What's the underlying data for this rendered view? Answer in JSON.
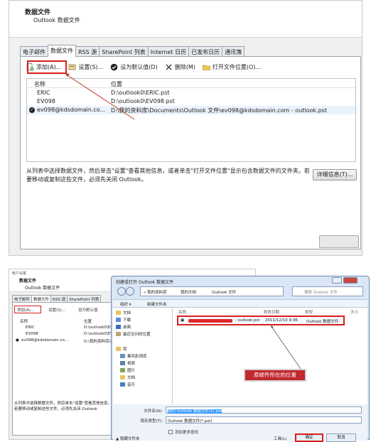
{
  "top": {
    "header_title": "数据文件",
    "header_subtitle": "Outlook 数据文件",
    "tabs": [
      "电子邮件",
      "数据文件",
      "RSS 源",
      "SharePoint 列表",
      "Internet 日历",
      "已发布日历",
      "通讯簿"
    ],
    "toolbar": {
      "add": "添加(A)...",
      "settings": "设置(S)...",
      "set_default": "设为默认值(D)",
      "remove": "删除(M)",
      "open_location": "打开文件位置(O)..."
    },
    "list_headers": {
      "name": "名称",
      "location": "位置"
    },
    "rows": [
      {
        "name": "ERIC",
        "location": "D:\\outlook0\\ERIC.pst"
      },
      {
        "name": "EV098",
        "location": "D:\\outlook0\\EV098.pst"
      },
      {
        "name": "ev098@kdsdomain.co...",
        "location": "D:\\我的资料库\\Documents\\Outlook 文件\\ev098@kdsdomain.com - outlook.pst"
      }
    ],
    "description": "从列表中选择数据文件，然后单击\"设置\"查看其他信息，或者单击\"打开文件位置\"显示包含数据文件的文件夹。若要移动或复制这些文件，必须先关闭 Outlook。",
    "details_button": "详细信息(T)..."
  },
  "bottom": {
    "account_window": {
      "window_title": "帐户设置",
      "header_title": "数据文件",
      "header_subtitle": "Outlook 数据文件",
      "tabs": [
        "电子邮件",
        "数据文件",
        "RSS 源",
        "SharePoint 列表"
      ],
      "toolbar": {
        "add": "添加(A)...",
        "settings": "设置(S)...",
        "set_default": "设为默认值"
      },
      "list_headers": {
        "name": "名称",
        "location": "位置"
      },
      "rows": [
        {
          "name": "ERIC",
          "location": "D:\\outlook0\\ERIC"
        },
        {
          "name": "EV098",
          "location": "D:\\outlook0\\EV09"
        },
        {
          "name": "ev098@kdsdomain.co...",
          "location": "D:\\我的资料库\\Doc"
        }
      ],
      "description": "从列表中选择数据文件，然后单击\"设置\"查看其他信息，夹。若要移动或复制这些文件，必须先关闭 Outlook"
    },
    "file_dialog": {
      "title": "创建或打开 Outlook 数据文件",
      "address": [
        "« 我的资料库",
        "我的文档",
        "Outlook 文件"
      ],
      "search_placeholder": "搜索 Outlook 文件",
      "cmd": {
        "organize": "组织 ▾",
        "new_folder": "新建文件夹"
      },
      "nav": [
        "文档",
        "下载",
        "桌面",
        "最近访问的位置",
        "库",
        "暴风影视库",
        "视频",
        "图片",
        "文档",
        "音乐"
      ],
      "columns": {
        "name": "名称",
        "modified": "修改日期",
        "type": "类型",
        "size": "大小"
      },
      "file": {
        "name_suffix": "- outlook.pst",
        "modified": "2011/12/10 9:36",
        "type": "Outlook 数据文件"
      },
      "callout": "原邮件所在的位置",
      "filename_label": "文件名(N):",
      "filename_value": "我的 Outlook 数据文件(1).pst",
      "filetype_label": "保存类型(T):",
      "filetype_value": "Outlook 数据文件(*.pst)",
      "checkbox": "添加更多密码",
      "hide_folders": "▲ 隐藏文件夹",
      "tools": "工具(L)",
      "ok": "确定",
      "cancel": "取消"
    }
  }
}
